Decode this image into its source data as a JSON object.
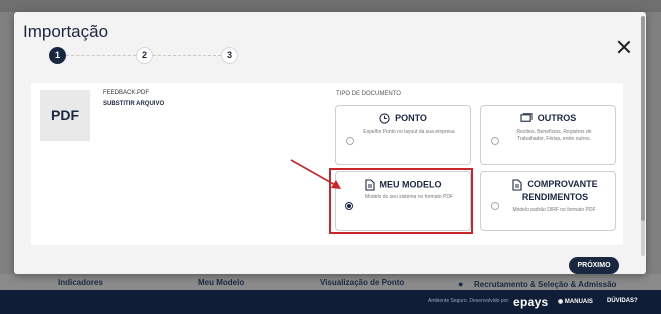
{
  "modal": {
    "title": "Importação",
    "steps": [
      "1",
      "2",
      "3"
    ],
    "active_step": 1
  },
  "file": {
    "icon_label": "PDF",
    "name": "FEEDBACK.PDF",
    "replace_label": "SUBSTITIR ARQUIVO"
  },
  "document_type": {
    "label": "TIPO DE DOCUMENTO",
    "options": [
      {
        "title": "PONTO",
        "icon": "clock-icon",
        "description": "Espelho Ponto no layout da sua empresa",
        "selected": false
      },
      {
        "title": "OUTROS",
        "icon": "cards-icon",
        "description": "Recibos, Benefícios, Registros de Trabalhador, Férias, entre outros.",
        "selected": false
      },
      {
        "title": "MEU MODELO",
        "icon": "document-icon",
        "description": "Modelo do seu sistema no formato PDF",
        "selected": true
      },
      {
        "title": "COMPROVANTE RENDIMENTOS",
        "icon": "document-icon",
        "description": "Modelo padrão DIRF no formato PDF",
        "selected": false
      }
    ]
  },
  "actions": {
    "next_label": "PRÓXIMO"
  },
  "background": {
    "nav": [
      "Indicadores",
      "Meu Modelo",
      "Visualização de Ponto"
    ],
    "recruit_label": "Recrutamento & Seleção & Admissão",
    "footer_text": "Ambiente Seguro. Desenvolvido por:",
    "footer_brand": "epays",
    "manuais": "MANUAIS",
    "duvidas": "DÚVIDAS?"
  },
  "colors": {
    "primary": "#1a2740",
    "highlight": "#c7262b",
    "footer": "#0f1e36"
  }
}
